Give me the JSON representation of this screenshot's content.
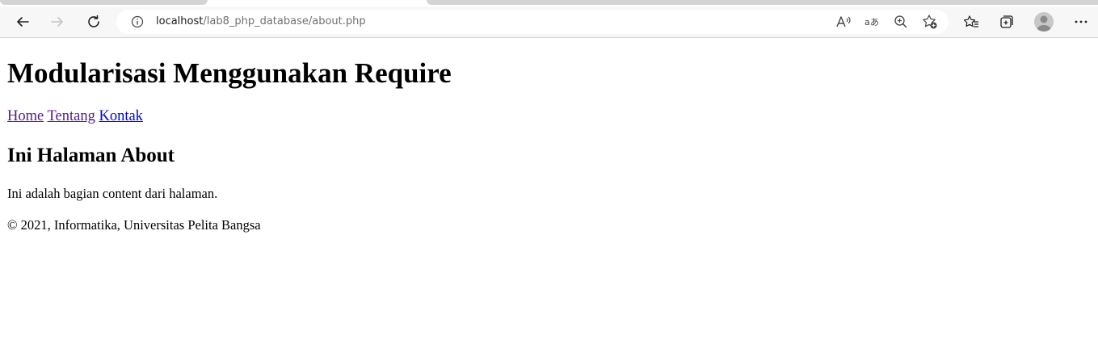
{
  "browser": {
    "url_host": "localhost",
    "url_path": "/lab8_php_database/about.php",
    "icons": {
      "back": "back-arrow-icon",
      "forward": "forward-arrow-icon",
      "refresh": "refresh-icon",
      "info": "info-icon",
      "read_aloud": "read-aloud-icon",
      "translate": "translate-icon",
      "zoom": "zoom-in-icon",
      "add_favorite": "add-favorite-icon",
      "favorites": "favorites-icon",
      "collections": "collections-icon",
      "profile": "profile-avatar",
      "menu": "more-menu-icon"
    }
  },
  "page": {
    "title": "Modularisasi Menggunakan Require",
    "nav": [
      {
        "label": "Home",
        "visited": true
      },
      {
        "label": "Tentang",
        "visited": true
      },
      {
        "label": "Kontak",
        "visited": false
      }
    ],
    "heading": "Ini Halaman About",
    "content": "Ini adalah bagian content dari halaman.",
    "footer": "© 2021, Informatika, Universitas Pelita Bangsa"
  },
  "colors": {
    "visited_link": "#551a8b",
    "link": "#0000ee",
    "toolbar_bg": "#f7f7f7"
  }
}
